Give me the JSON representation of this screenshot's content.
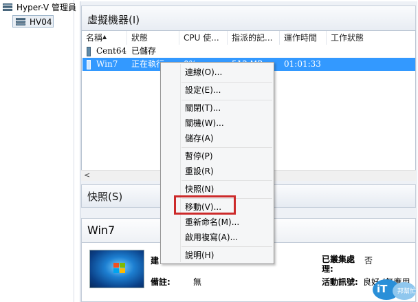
{
  "tree": {
    "root_label": "Hyper-V 管理員",
    "server_label": "HV04"
  },
  "vm_section": {
    "title": "虛擬機器(I)"
  },
  "columns": [
    "名稱",
    "狀態",
    "CPU 使...",
    "指派的記...",
    "運作時間",
    "工作狀態"
  ],
  "vms": [
    {
      "name": "Cent64",
      "state": "已儲存",
      "cpu": "",
      "mem": "",
      "uptime": "",
      "status": ""
    },
    {
      "name": "Win7",
      "state": "正在執行",
      "cpu": "0%",
      "mem": "512 MB",
      "uptime": "01:01:33",
      "status": ""
    }
  ],
  "scroll_left_glyph": "<",
  "snapshot_section": {
    "title": "快照(S)"
  },
  "detail": {
    "title": "Win7",
    "created_label": "建",
    "notes_label": "備註:",
    "notes_value": "無",
    "clustered_label": "已叢集處理:",
    "clustered_value": "否",
    "heartbeat_label": "活動訊號:",
    "heartbeat_value": "良好 (無應用"
  },
  "context_menu": {
    "items": [
      {
        "label": "連線(O)..."
      },
      {
        "label": "設定(E)..."
      },
      {
        "label": "關閉(T)..."
      },
      {
        "label": "關機(W)..."
      },
      {
        "label": "儲存(A)"
      },
      {
        "label": "暫停(P)"
      },
      {
        "label": "重設(R)"
      },
      {
        "label": "快照(N)"
      },
      {
        "label": "移動(V)..."
      },
      {
        "label": "重新命名(M)..."
      },
      {
        "label": "啟用複寫(A)..."
      },
      {
        "label": "說明(H)"
      }
    ],
    "highlighted": "移動(V)...",
    "highlight_color": "#cc2a2a"
  },
  "watermark": {
    "text1": "iT",
    "text2": "邦幫忙"
  },
  "colors": {
    "selection": "#3399ff",
    "accent": "#1d7fd1"
  }
}
